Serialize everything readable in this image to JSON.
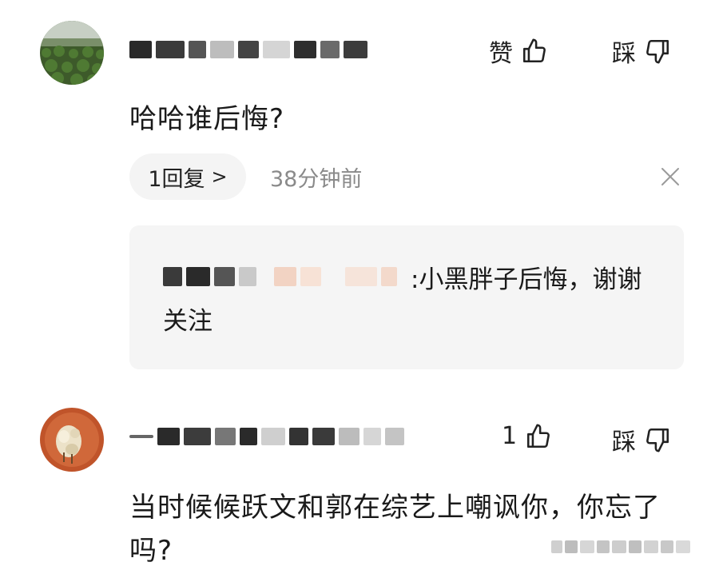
{
  "comments": [
    {
      "text": "哈哈谁后悔?",
      "like_label": "赞",
      "dislike_label": "踩",
      "reply_count_label": "1回复",
      "reply_chevron": ">",
      "timestamp": "38分钟前",
      "reply": {
        "separator": ":",
        "text": "小黑胖子后悔，谢谢关注"
      }
    },
    {
      "text": "当时候候跃文和郭在综艺上嘲讽你，你忘了吗?",
      "like_label": "1",
      "dislike_label": "踩"
    }
  ],
  "icons": {
    "like": "thumbs-up-icon",
    "dislike": "thumbs-down-icon",
    "close": "close-icon",
    "chevron": "chevron-right-icon"
  },
  "colors": {
    "text": "#1a1a1a",
    "muted": "#8a8a8a",
    "pill_bg": "#f4f4f4",
    "reply_bg": "#f5f5f5"
  }
}
